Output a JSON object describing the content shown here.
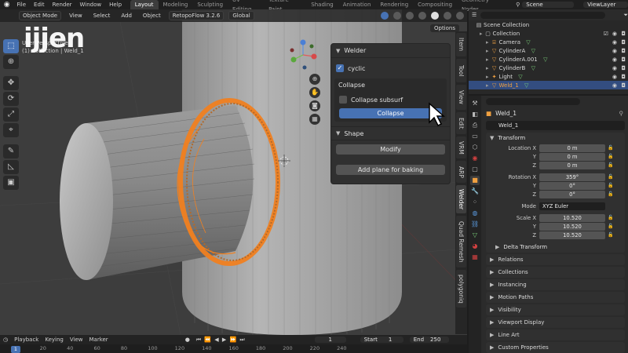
{
  "topbar": {
    "menus": [
      "File",
      "Edit",
      "Render",
      "Window",
      "Help"
    ],
    "workspaces": [
      "Layout",
      "Modeling",
      "Sculpting",
      "UV Editing",
      "Texture Paint",
      "Shading",
      "Animation",
      "Rendering",
      "Compositing",
      "Geometry Nodes"
    ],
    "active_workspace": "Layout",
    "scene_label": "Scene",
    "viewlayer_label": "ViewLayer"
  },
  "viewport_header": {
    "mode": "Object Mode",
    "menus": [
      "View",
      "Select",
      "Add",
      "Object"
    ],
    "addon": "RetopoFlow 3.2.6",
    "transform": "Global",
    "options": "Options"
  },
  "viewport_overlay": {
    "line1": "User Perspective",
    "line2": "(1) Collection | Weld_1",
    "watermark": "ijjen"
  },
  "welder_panel": {
    "title": "Welder",
    "cyclic_label": "cyclic",
    "cyclic_checked": true,
    "collapse_title": "Collapse",
    "collapse_subsurf_label": "Collapse subsurf",
    "collapse_subsurf_checked": false,
    "collapse_button": "Collapse"
  },
  "shape_panel": {
    "title": "Shape",
    "modify_button": "Modify",
    "bake_button": "Add plane for baking"
  },
  "side_tabs": [
    "Item",
    "Tool",
    "View",
    "Edit",
    "VRM",
    "ARP",
    "Welder",
    "Quad Remesh",
    "polygoniq"
  ],
  "active_side_tab": "Welder",
  "timeline": {
    "menus": [
      "Playback",
      "Keying",
      "View",
      "Marker"
    ],
    "current_frame": "1",
    "start_label": "Start",
    "start": "1",
    "end_label": "End",
    "end": "250",
    "ticks": [
      "1",
      "20",
      "40",
      "60",
      "80",
      "100",
      "120",
      "140",
      "160",
      "180",
      "200",
      "220",
      "240"
    ]
  },
  "outliner": {
    "root": "Scene Collection",
    "items": [
      {
        "name": "Collection",
        "icon": "collection-icon",
        "indent": 1,
        "selected": false
      },
      {
        "name": "Camera",
        "icon": "camera-icon",
        "indent": 2,
        "selected": false
      },
      {
        "name": "CylinderA",
        "icon": "mesh-icon",
        "indent": 2,
        "selected": false
      },
      {
        "name": "CylinderA.001",
        "icon": "mesh-icon",
        "indent": 2,
        "selected": false
      },
      {
        "name": "CylinderB",
        "icon": "mesh-icon",
        "indent": 2,
        "selected": false
      },
      {
        "name": "Light",
        "icon": "light-icon",
        "indent": 2,
        "selected": false
      },
      {
        "name": "Weld_1",
        "icon": "mesh-icon",
        "indent": 2,
        "selected": true
      }
    ]
  },
  "properties": {
    "object_name": "Weld_1",
    "name_field": "Weld_1",
    "transform_title": "Transform",
    "location": {
      "label": "Location X",
      "x": "0 m",
      "y": "0 m",
      "z": "0 m"
    },
    "rotation": {
      "label": "Rotation X",
      "x": "359°",
      "y": "0°",
      "z": "0°"
    },
    "mode_label": "Mode",
    "mode_value": "XYZ Euler",
    "scale": {
      "label": "Scale X",
      "x": "10.520",
      "y": "10.520",
      "z": "10.520"
    },
    "axis_y": "Y",
    "axis_z": "Z",
    "delta_transform": "Delta Transform",
    "sections": [
      "Relations",
      "Collections",
      "Instancing",
      "Motion Paths",
      "Visibility",
      "Viewport Display",
      "Line Art",
      "Custom Properties"
    ]
  },
  "colors": {
    "accent": "#4772b3",
    "selection_orange": "#f08020",
    "viewport_bg": "#3d3d3d"
  }
}
